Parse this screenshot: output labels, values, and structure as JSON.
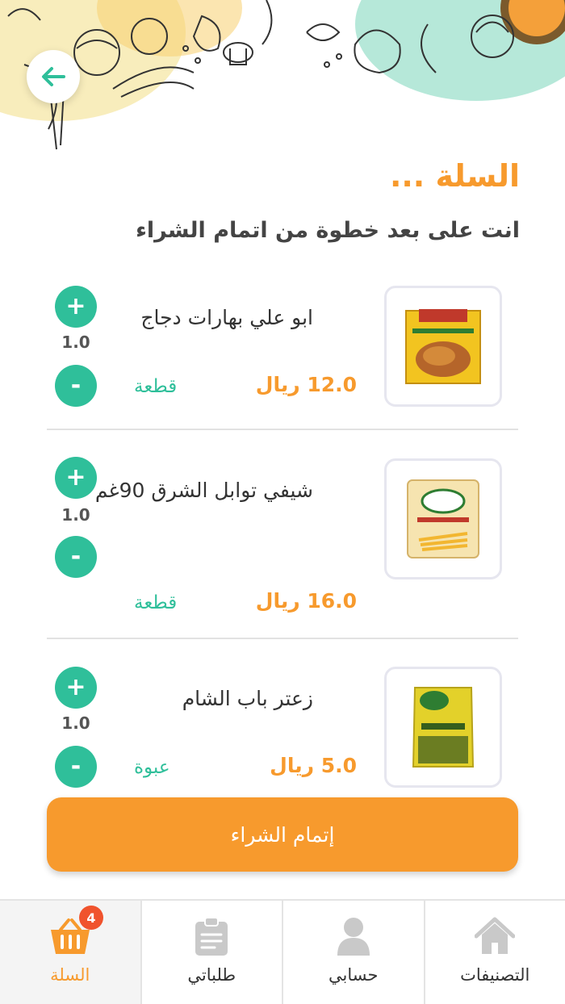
{
  "header": {
    "title": "السلة ...",
    "subtitle": "انت على بعد خطوة من اتمام الشراء"
  },
  "cart_items": [
    {
      "name": "ابو علي بهارات دجاج",
      "price": "12.0 ريال",
      "unit": "قطعة",
      "qty": "1.0",
      "plus": "+",
      "minus": "-",
      "image": "chicken-spices-box"
    },
    {
      "name": "شيفي توابل الشرق 90غم",
      "price": "16.0 ريال",
      "unit": "قطعة",
      "qty": "1.0",
      "plus": "+",
      "minus": "-",
      "image": "fries-seasoning-pack"
    },
    {
      "name": "زعتر باب الشام",
      "price": "5.0 ريال",
      "unit": "عبوة",
      "qty": "1.0",
      "plus": "+",
      "minus": "-",
      "image": "zaatar-pack"
    }
  ],
  "checkout": {
    "label": "إتمام الشراء"
  },
  "bottom_nav": [
    {
      "label": "السلة",
      "icon": "basket-icon",
      "active": true,
      "badge": "4"
    },
    {
      "label": "طلباتي",
      "icon": "clipboard-icon",
      "active": false
    },
    {
      "label": "حسابي",
      "icon": "user-icon",
      "active": false
    },
    {
      "label": "التصنيفات",
      "icon": "home-icon",
      "active": false
    }
  ],
  "colors": {
    "accent": "#f79a2d",
    "green": "#2fbf9a",
    "badge": "#f0532d"
  }
}
